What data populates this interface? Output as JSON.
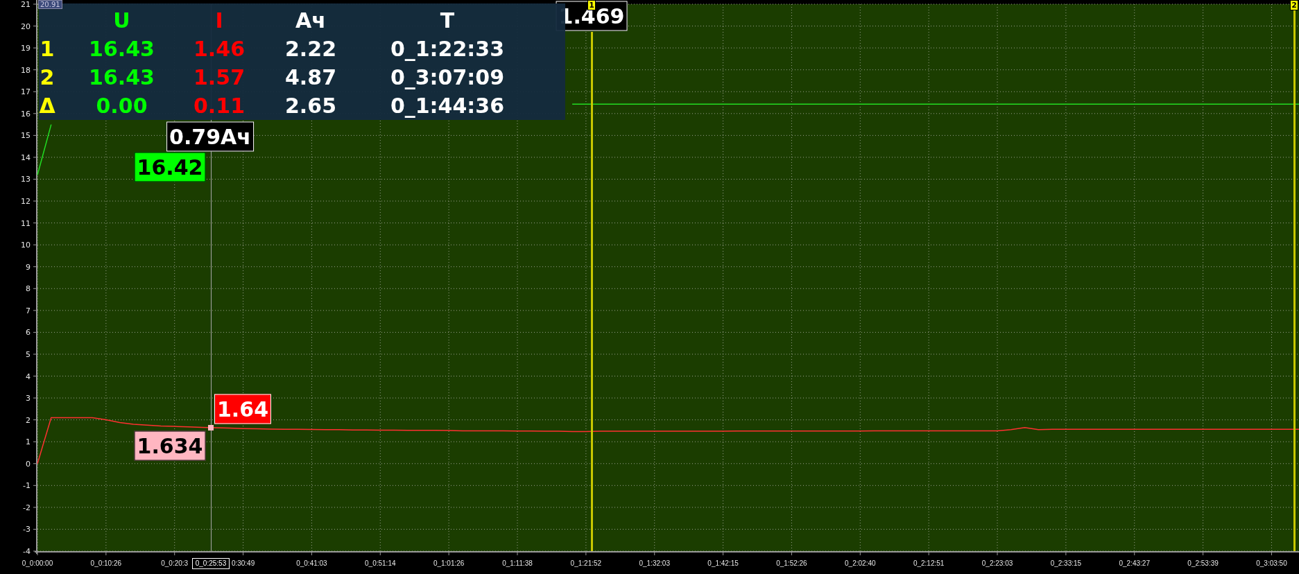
{
  "corner_label": "20.91",
  "readout_table": {
    "columns": [
      {
        "color": "#ffff00"
      },
      {
        "label": "U",
        "color": "#00ff00"
      },
      {
        "label": "I",
        "color": "#ff0000"
      },
      {
        "label": "Ач",
        "color": "#ffffff"
      },
      {
        "label": "T",
        "color": "#ffffff"
      }
    ],
    "rows": [
      {
        "cells": [
          "1",
          "16.43",
          "1.46",
          "2.22",
          "0_1:22:33"
        ]
      },
      {
        "cells": [
          "2",
          "16.43",
          "1.57",
          "4.87",
          "0_3:07:09"
        ]
      },
      {
        "cells": [
          "Δ",
          "0.00",
          "0.11",
          "2.65",
          "0_1:44:36"
        ]
      }
    ]
  },
  "chart_data": {
    "type": "line",
    "grid": true,
    "ylim": [
      -4,
      21
    ],
    "categories": [
      "0_0:00:00",
      null,
      null,
      null,
      null,
      "0_0:10:26",
      null,
      null,
      null,
      null,
      "0_0:20:3",
      null,
      null,
      null,
      null,
      "0:30:49",
      null,
      null,
      null,
      null,
      "0_0:41:03",
      null,
      null,
      null,
      null,
      "0_0:51:14",
      null,
      null,
      null,
      null,
      "0_1:01:26",
      null,
      null,
      null,
      null,
      "0_1:11:38",
      null,
      null,
      null,
      null,
      "0_1:21:52",
      null,
      null,
      null,
      null,
      "0_1:32:03",
      null,
      null,
      null,
      null,
      "0_1:42:15",
      null,
      null,
      null,
      null,
      "0_1:52:26",
      null,
      null,
      null,
      null,
      "0_2:02:40",
      null,
      null,
      null,
      null,
      "0_2:12:51",
      null,
      null,
      null,
      null,
      "0_2:23:03",
      null,
      null,
      null,
      null,
      "0_2:33:15",
      null,
      null,
      null,
      null,
      "0_2:43:27",
      null,
      null,
      null,
      null,
      "0_2:53:39",
      null,
      null,
      null,
      null,
      "0_3:03:50",
      null,
      null
    ],
    "series": [
      {
        "color": "#22dd22",
        "values": [
          13.2,
          15.5,
          null,
          null,
          null,
          null,
          null,
          null,
          null,
          null,
          null,
          null,
          null,
          null,
          null,
          null,
          null,
          null,
          null,
          null,
          null,
          null,
          null,
          null,
          null,
          null,
          null,
          null,
          null,
          null,
          null,
          null,
          null,
          null,
          null,
          null,
          null,
          null,
          null,
          16.43,
          16.43,
          16.43,
          16.43,
          16.43,
          16.43,
          16.43,
          16.43,
          16.43,
          16.43,
          16.43,
          16.43,
          16.43,
          16.43,
          16.43,
          16.43,
          16.43,
          16.43,
          16.43,
          16.43,
          16.43,
          16.43,
          16.43,
          16.43,
          16.43,
          16.43,
          16.43,
          16.43,
          16.43,
          16.43,
          16.43,
          16.43,
          16.43,
          16.43,
          16.43,
          16.43,
          16.43,
          16.43,
          16.43,
          16.43,
          16.43,
          16.43,
          16.43,
          16.43,
          16.43,
          16.43,
          16.43,
          16.43,
          16.43,
          16.43,
          16.43,
          16.43,
          16.43,
          16.43
        ]
      },
      {
        "color": "#ff3030",
        "values": [
          0,
          2.1,
          2.1,
          2.1,
          2.1,
          2.0,
          1.88,
          1.8,
          1.76,
          1.72,
          1.7,
          1.68,
          1.66,
          1.64,
          1.62,
          1.6,
          1.59,
          1.58,
          1.57,
          1.57,
          1.56,
          1.55,
          1.55,
          1.54,
          1.54,
          1.53,
          1.53,
          1.52,
          1.52,
          1.52,
          1.51,
          1.5,
          1.5,
          1.5,
          1.5,
          1.49,
          1.49,
          1.48,
          1.48,
          1.47,
          1.47,
          1.48,
          1.48,
          1.48,
          1.48,
          1.48,
          1.48,
          1.48,
          1.48,
          1.48,
          1.48,
          1.49,
          1.49,
          1.49,
          1.49,
          1.49,
          1.49,
          1.49,
          1.49,
          1.49,
          1.49,
          1.5,
          1.5,
          1.5,
          1.5,
          1.5,
          1.5,
          1.5,
          1.5,
          1.5,
          1.5,
          1.55,
          1.65,
          1.55,
          1.57,
          1.57,
          1.57,
          1.57,
          1.57,
          1.57,
          1.57,
          1.57,
          1.57,
          1.57,
          1.57,
          1.57,
          1.57,
          1.57,
          1.57,
          1.57,
          1.57,
          1.57,
          1.57
        ]
      }
    ],
    "yticks": [
      -4,
      -3,
      -2,
      -1,
      0,
      1,
      2,
      3,
      4,
      5,
      6,
      7,
      8,
      9,
      10,
      11,
      12,
      13,
      14,
      15,
      16,
      17,
      18,
      19,
      20,
      21
    ]
  },
  "cursors": [
    {
      "label": "1"
    },
    {
      "label": "2"
    }
  ],
  "probe": {
    "time_label": "0_0:25:53"
  },
  "markers": [
    {
      "text": "1.469",
      "color": "#000000"
    },
    {
      "text": "0.79Ач",
      "color": "#000000"
    },
    {
      "text": "16.42",
      "color": "#00ff00"
    },
    {
      "text": "1.64",
      "color": "#ff0000"
    },
    {
      "text": "1.634",
      "color": "#ffb6c1"
    }
  ]
}
